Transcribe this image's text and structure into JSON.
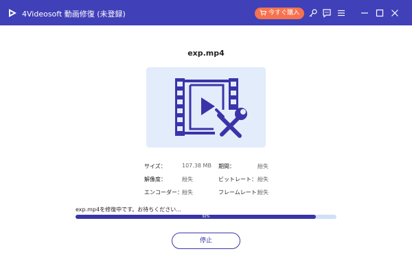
{
  "app": {
    "title": "4Videosoft 動画修復 (未登録)",
    "buy_label": "今すぐ購入",
    "colors": {
      "titlebar": "#4040b8",
      "buy": "#f6724f",
      "accent": "#3a34a8",
      "preview_bg": "#e3ecfb"
    }
  },
  "toolbar": {
    "icons": [
      "key-icon",
      "feedback-icon",
      "menu-icon",
      "minimize-icon",
      "maximize-icon",
      "close-icon"
    ]
  },
  "file": {
    "name": "exp.mp4",
    "preview_icon": "video-repair-icon"
  },
  "info": {
    "size_label": "サイズ：",
    "size_value": "107.38 MB",
    "duration_label": "期間：",
    "duration_value": "紛失",
    "resolution_label": "解像度：",
    "resolution_value": "紛失",
    "bitrate_label": "ビットレート：",
    "bitrate_value": "紛失",
    "encoder_label": "エンコーダー：",
    "encoder_value": "紛失",
    "framerate_label": "フレームレート：",
    "framerate_value": "紛失"
  },
  "progress": {
    "status": "exp.mp4を修復中です。お待ちください...",
    "percent_label": "92%",
    "percent": 92
  },
  "stop_label": "停止"
}
